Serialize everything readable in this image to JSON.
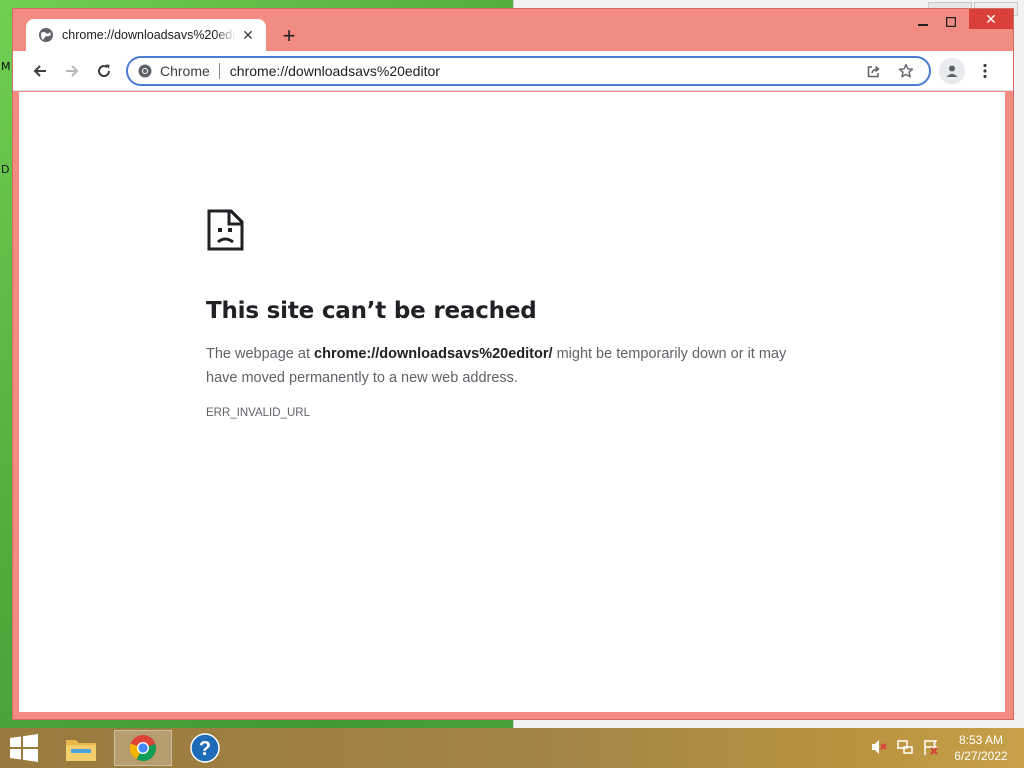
{
  "desktop": {
    "left_edge_letters": [
      "M",
      "D"
    ]
  },
  "browser": {
    "tab": {
      "title": "chrome://downloadsavs%20editor",
      "close_glyph": "✕"
    },
    "new_tab_glyph": "+",
    "window_controls": {
      "minimize": "—",
      "maximize": "☐",
      "close": "✕"
    },
    "omnibox": {
      "chip": "Chrome",
      "url": "chrome://downloadsavs%20editor"
    },
    "icons": [
      "back-icon",
      "forward-icon",
      "reload-icon",
      "share-icon",
      "bookmark-star-icon",
      "profile-icon",
      "kebab-menu-icon"
    ]
  },
  "error_page": {
    "title": "This site can’t be reached",
    "body_prefix": "The webpage at ",
    "body_url": "chrome://downloadsavs%20editor/",
    "body_suffix": " might be temporarily down or it may have moved permanently to a new web address.",
    "code": "ERR_INVALID_URL"
  },
  "taskbar": {
    "apps": [
      "file-explorer",
      "chrome",
      "help"
    ],
    "clock": {
      "time": "8:53 AM",
      "date": "6/27/2022"
    }
  }
}
